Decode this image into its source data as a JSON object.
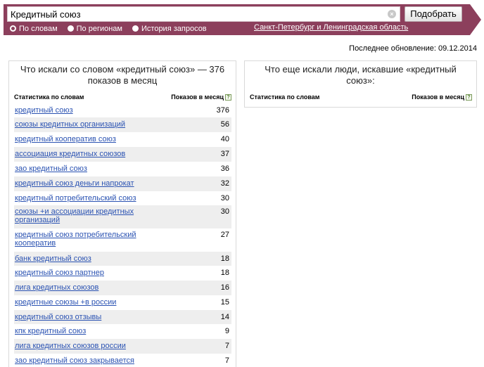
{
  "search": {
    "query": "Кредитный союз",
    "clear_icon": "close-circle-icon",
    "submit_label": "Подобрать"
  },
  "modes": [
    {
      "label": "По словам",
      "checked": true
    },
    {
      "label": "По регионам",
      "checked": false
    },
    {
      "label": "История запросов",
      "checked": false
    }
  ],
  "region": "Санкт-Петербург и Ленинградская область",
  "updated": "Последнее обновление: 09.12.2014",
  "colors": {
    "brand": "#8c3f5c",
    "link": "#2a52b2"
  },
  "left_panel": {
    "title": "Что искали со словом «кредитный союз» — 376 показов в месяц",
    "col_left": "Статистика по словам",
    "col_right": "Показов в месяц",
    "rows": [
      {
        "phrase": "кредитный союз",
        "count": "376"
      },
      {
        "phrase": "союзы кредитных организаций",
        "count": "56"
      },
      {
        "phrase": "кредитный кооператив союз",
        "count": "40"
      },
      {
        "phrase": "ассоциация кредитных союзов",
        "count": "37"
      },
      {
        "phrase": "зао кредитный союз",
        "count": "36"
      },
      {
        "phrase": "кредитный союз деньги напрокат",
        "count": "32"
      },
      {
        "phrase": "кредитный потребительский союз",
        "count": "30"
      },
      {
        "phrase": "союзы +и ассоциации кредитных организаций",
        "count": "30"
      },
      {
        "phrase": "кредитный союз потребительский кооператив",
        "count": "27"
      },
      {
        "phrase": "банк кредитный союз",
        "count": "18"
      },
      {
        "phrase": "кредитный союз партнер",
        "count": "18"
      },
      {
        "phrase": "лига кредитных союзов",
        "count": "16"
      },
      {
        "phrase": "кредитные союзы +в россии",
        "count": "15"
      },
      {
        "phrase": "кредитный союз отзывы",
        "count": "14"
      },
      {
        "phrase": "кпк кредитный союз",
        "count": "9"
      },
      {
        "phrase": "лига кредитных союзов россии",
        "count": "7"
      },
      {
        "phrase": "зао кредитный союз закрывается",
        "count": "7"
      }
    ]
  },
  "right_panel": {
    "title": "Что еще искали люди, искавшие «кредитный союз»:",
    "col_left": "Статистика по словам",
    "col_right": "Показов в месяц"
  }
}
